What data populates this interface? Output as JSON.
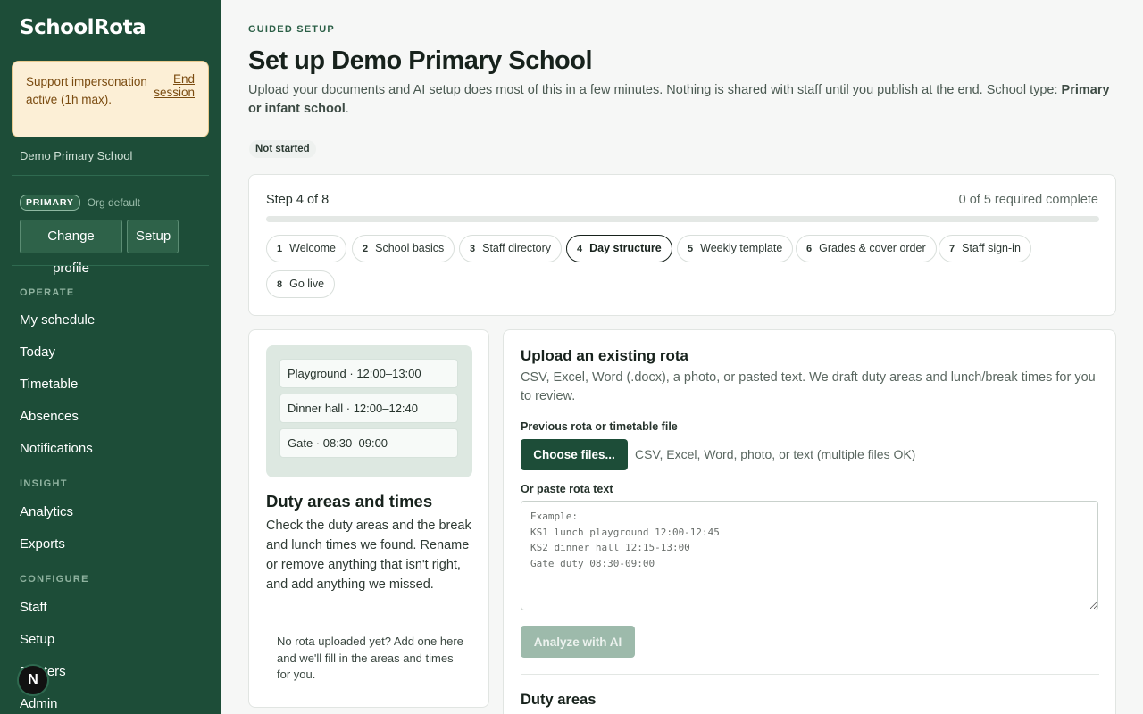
{
  "sidebar": {
    "logo": "SchoolRota",
    "impersonation": {
      "message": "Support impersonation active (1h max).",
      "end_label": "End session"
    },
    "school_name": "Demo Primary School",
    "profile": {
      "badge": "PRIMARY",
      "org_default": "Org default",
      "change_profile": "Change profile",
      "setup": "Setup"
    },
    "sections": {
      "operate": "OPERATE",
      "insight": "INSIGHT",
      "configure": "CONFIGURE"
    },
    "operate_items": [
      "My schedule",
      "Today",
      "Timetable",
      "Absences",
      "Notifications"
    ],
    "insight_items": [
      "Analytics",
      "Exports"
    ],
    "configure_items": [
      "Staff",
      "Setup",
      "Rosters",
      "Admin"
    ],
    "avatar_letter": "N"
  },
  "header": {
    "eyebrow": "GUIDED SETUP",
    "title": "Set up Demo Primary School",
    "intro": "Upload your documents and AI setup does most of this in a few minutes. Nothing is shared with staff until you publish at the end. School type: ",
    "school_type": "Primary or infant school",
    "intro_end": ".",
    "status": "Not started"
  },
  "steps": {
    "step_label": "Step 4 of 8",
    "required_label": "0 of 5 required complete",
    "progress_fraction": 0,
    "items": [
      {
        "num": "1",
        "label": "Welcome"
      },
      {
        "num": "2",
        "label": "School basics"
      },
      {
        "num": "3",
        "label": "Staff directory"
      },
      {
        "num": "4",
        "label": "Day structure",
        "active": true
      },
      {
        "num": "5",
        "label": "Weekly template"
      },
      {
        "num": "6",
        "label": "Grades & cover order"
      },
      {
        "num": "7",
        "label": "Staff sign-in"
      },
      {
        "num": "8",
        "label": "Go live"
      }
    ]
  },
  "info": {
    "preview": [
      "Playground · 12:00–13:00",
      "Dinner hall · 12:00–12:40",
      "Gate · 08:30–09:00"
    ],
    "title": "Duty areas and times",
    "text": "Check the duty areas and the break and lunch times we found. Rename or remove anything that isn't right, and add anything we missed.",
    "note": "No rota uploaded yet? Add one here and we'll fill in the areas and times for you."
  },
  "upload": {
    "title": "Upload an existing rota",
    "description": "CSV, Excel, Word (.docx), a photo, or pasted text. We draft duty areas and lunch/break times for you to review.",
    "file_label": "Previous rota or timetable file",
    "choose_button": "Choose files...",
    "file_hint": "CSV, Excel, Word, photo, or text (multiple files OK)",
    "paste_label": "Or paste rota text",
    "paste_placeholder": "Example:\nKS1 lunch playground 12:00-12:45\nKS2 dinner hall 12:15-13:00\nGate duty 08:30-09:00",
    "analyze_button": "Analyze with AI",
    "duty_areas_heading": "Duty areas"
  },
  "colors": {
    "sidebar_bg": "#1d4d38",
    "accent": "#1d4d38",
    "impersonation_bg": "#fcefd6"
  }
}
